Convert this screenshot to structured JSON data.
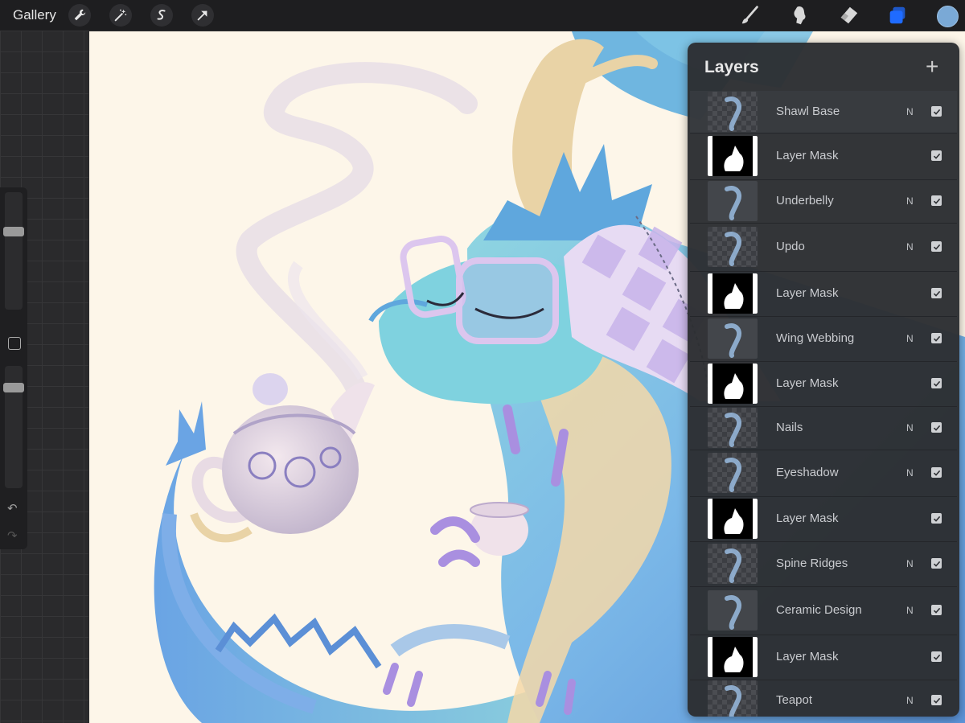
{
  "toolbar": {
    "gallery_label": "Gallery",
    "left_tools": [
      "wrench-icon",
      "magic-wand-icon",
      "selection-icon",
      "transform-arrow-icon"
    ],
    "right_tools": [
      "brush-icon",
      "smudge-icon",
      "eraser-icon",
      "layers-icon"
    ],
    "current_color": "#7aa9d6",
    "active_tool_color": "#1f6bff"
  },
  "sidebar": {
    "brush_size_level": 0.32,
    "opacity_level": 0.15,
    "icons": [
      "modify-square-icon",
      "undo-icon",
      "redo-icon"
    ]
  },
  "layers_panel": {
    "title": "Layers",
    "add_icon": "plus-icon",
    "layers": [
      {
        "name": "Shawl Base",
        "blend": "N",
        "visible": true,
        "thumb": "checker"
      },
      {
        "name": "Layer Mask",
        "blend": "",
        "visible": true,
        "thumb": "mask"
      },
      {
        "name": "Underbelly",
        "blend": "N",
        "visible": true,
        "thumb": "solid"
      },
      {
        "name": "Updo",
        "blend": "N",
        "visible": true,
        "thumb": "checker"
      },
      {
        "name": "Layer Mask",
        "blend": "",
        "visible": true,
        "thumb": "mask"
      },
      {
        "name": "Wing Webbing",
        "blend": "N",
        "visible": true,
        "thumb": "solid"
      },
      {
        "name": "Layer Mask",
        "blend": "",
        "visible": true,
        "thumb": "mask"
      },
      {
        "name": "Nails",
        "blend": "N",
        "visible": true,
        "thumb": "checker"
      },
      {
        "name": "Eyeshadow",
        "blend": "N",
        "visible": true,
        "thumb": "checker"
      },
      {
        "name": "Layer Mask",
        "blend": "",
        "visible": true,
        "thumb": "mask"
      },
      {
        "name": "Spine Ridges",
        "blend": "N",
        "visible": true,
        "thumb": "checker"
      },
      {
        "name": "Ceramic Design",
        "blend": "N",
        "visible": true,
        "thumb": "solid"
      },
      {
        "name": "Layer Mask",
        "blend": "",
        "visible": true,
        "thumb": "mask"
      },
      {
        "name": "Teapot",
        "blend": "N",
        "visible": true,
        "thumb": "checker"
      }
    ]
  }
}
